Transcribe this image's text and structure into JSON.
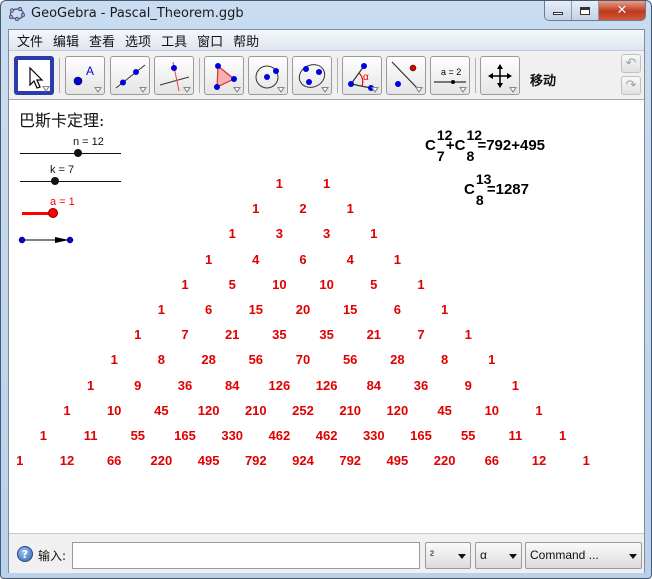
{
  "window": {
    "title": "GeoGebra - Pascal_Theorem.ggb",
    "controls": {
      "minimize": "minimize",
      "maximize": "maximize",
      "close": "✕"
    }
  },
  "menu": [
    "文件",
    "编辑",
    "查看",
    "选项",
    "工具",
    "窗口",
    "帮助"
  ],
  "toolbar": {
    "tools": [
      {
        "name": "move-tool",
        "icon": "arrow-cursor-icon",
        "selected": true
      },
      {
        "name": "point-tool",
        "icon": "point-icon"
      },
      {
        "name": "line-tool",
        "icon": "line-through-points-icon"
      },
      {
        "name": "perpendicular-line-tool",
        "icon": "perpendicular-icon"
      },
      {
        "name": "polygon-tool",
        "icon": "polygon-icon"
      },
      {
        "name": "circle-tool",
        "icon": "circle-center-point-icon"
      },
      {
        "name": "conic-tool",
        "icon": "conic-five-points-icon"
      },
      {
        "name": "angle-tool",
        "icon": "angle-icon"
      },
      {
        "name": "reflect-tool",
        "icon": "reflect-line-icon"
      },
      {
        "name": "slider-tool",
        "icon": "slider-icon",
        "label": "a = 2"
      },
      {
        "name": "move-graphics-tool",
        "icon": "move-arrows-icon"
      }
    ],
    "active_tool_label": "移动",
    "undo": "↶",
    "redo": "↷",
    "angle_glyph": "α"
  },
  "graphics": {
    "heading": "巴斯卡定理:",
    "sliders": [
      {
        "label": "n = 12",
        "name": "n",
        "value": 12,
        "color": "#000000"
      },
      {
        "label": "k = 7",
        "name": "k",
        "value": 7,
        "color": "#000000"
      },
      {
        "label": "a = 1",
        "name": "a",
        "value": 1,
        "color": "#ff0000"
      }
    ],
    "formula1": {
      "c1_sup": "12",
      "c1_sub": "7",
      "plus": "+",
      "c2_sup": "12",
      "c2_sub": "8",
      "rhs": "=792+495",
      "C": "C"
    },
    "formula2": {
      "sup": "13",
      "sub": "8",
      "rhs": "=1287",
      "C": "C"
    },
    "triangle_color": "#e00000",
    "pascal_rows": [
      [
        1,
        1
      ],
      [
        1,
        2,
        1
      ],
      [
        1,
        3,
        3,
        1
      ],
      [
        1,
        4,
        6,
        4,
        1
      ],
      [
        1,
        5,
        10,
        10,
        5,
        1
      ],
      [
        1,
        6,
        15,
        20,
        15,
        6,
        1
      ],
      [
        1,
        7,
        21,
        35,
        35,
        21,
        7,
        1
      ],
      [
        1,
        8,
        28,
        56,
        70,
        56,
        28,
        8,
        1
      ],
      [
        1,
        9,
        36,
        84,
        126,
        126,
        84,
        36,
        9,
        1
      ],
      [
        1,
        10,
        45,
        120,
        210,
        252,
        210,
        120,
        45,
        10,
        1
      ],
      [
        1,
        11,
        55,
        165,
        330,
        462,
        462,
        330,
        165,
        55,
        11,
        1
      ],
      [
        1,
        12,
        66,
        220,
        495,
        792,
        924,
        792,
        495,
        220,
        66,
        12,
        1
      ]
    ]
  },
  "inputbar": {
    "help": "?",
    "label": "输入:",
    "value": "",
    "superscript_combo": "²",
    "greek_combo": "α",
    "command_combo": "Command ..."
  }
}
